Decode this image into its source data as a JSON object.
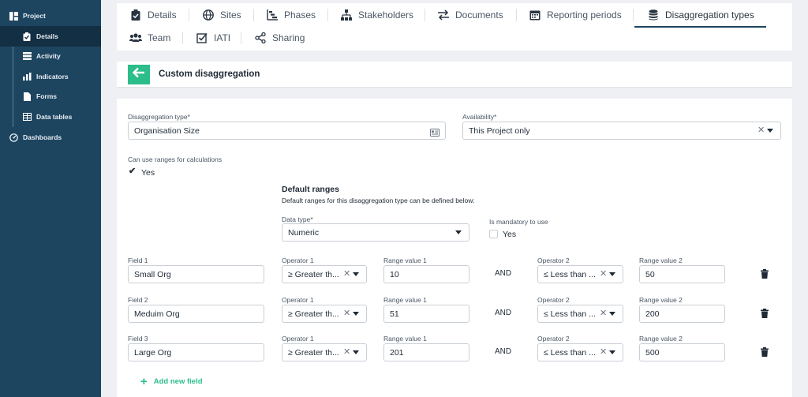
{
  "sidebar": {
    "items": [
      {
        "label": "Project",
        "icon": "project-icon"
      },
      {
        "label": "Details",
        "icon": "clipboard-check-icon"
      },
      {
        "label": "Activity",
        "icon": "list-icon"
      },
      {
        "label": "Indicators",
        "icon": "bar-chart-icon"
      },
      {
        "label": "Forms",
        "icon": "file-icon"
      },
      {
        "label": "Data tables",
        "icon": "table-icon"
      },
      {
        "label": "Dashboards",
        "icon": "dashboard-icon"
      }
    ]
  },
  "tabs": {
    "details": "Details",
    "sites": "Sites",
    "phases": "Phases",
    "stakeholders": "Stakeholders",
    "documents": "Documents",
    "reporting_periods": "Reporting periods",
    "disaggregation_types": "Disaggregation types",
    "team": "Team",
    "iati": "IATI",
    "sharing": "Sharing"
  },
  "page": {
    "title": "Custom disaggregation"
  },
  "form": {
    "disaggregation_type_label": "Disaggregation type*",
    "disaggregation_type_value": "Organisation Size",
    "availability_label": "Availability*",
    "availability_value": "This Project only",
    "ranges_label": "Can use ranges for calculations",
    "ranges_checked_label": "Yes",
    "default_ranges_title": "Default ranges",
    "default_ranges_desc": "Default ranges for this disaggregation type can be defined below:",
    "data_type_label": "Data type*",
    "data_type_value": "Numeric",
    "mandatory_label": "Is mandatory to use",
    "mandatory_option": "Yes",
    "and_label": "AND",
    "add_field": "Add new field",
    "rows": [
      {
        "field_label": "Field 1",
        "field_value": "Small Org",
        "op1_label": "Operator 1",
        "op1_value": "≥ Greater th...",
        "rv1_label": "Range value 1",
        "rv1_value": "10",
        "op2_label": "Operator 2",
        "op2_value": "≤ Less than ...",
        "rv2_label": "Range value 2",
        "rv2_value": "50"
      },
      {
        "field_label": "Field 2",
        "field_value": "Meduim Org",
        "op1_label": "Operator 1",
        "op1_value": "≥ Greater th...",
        "rv1_label": "Range value 1",
        "rv1_value": "51",
        "op2_label": "Operator 2",
        "op2_value": "≤ Less than ...",
        "rv2_label": "Range value 2",
        "rv2_value": "200"
      },
      {
        "field_label": "Field 3",
        "field_value": "Large Org",
        "op1_label": "Operator 1",
        "op1_value": "≥ Greater th...",
        "rv1_label": "Range value 1",
        "rv1_value": "201",
        "op2_label": "Operator 2",
        "op2_value": "≤ Less than ...",
        "rv2_label": "Range value 2",
        "rv2_value": "500"
      }
    ]
  },
  "colors": {
    "sidebar": "#1e4560",
    "accent": "#2bbd8a",
    "background": "#eef0f3"
  }
}
